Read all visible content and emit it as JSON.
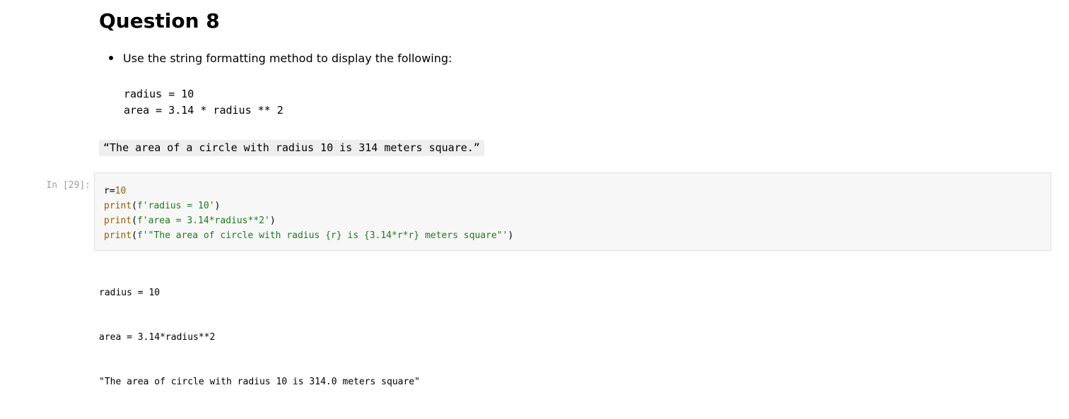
{
  "markdown": {
    "heading": "Question 8",
    "bullet": "Use the string formatting method to display the following:",
    "code_lines": [
      "radius = 10",
      "area = 3.14 * radius ** 2"
    ],
    "quote": "“The area of a circle with radius 10 is 314 meters square.”"
  },
  "code_cell": {
    "prompt": "In [29]:",
    "lines": [
      [
        {
          "text": "r=",
          "type": "plain"
        },
        {
          "text": "10",
          "type": "number"
        }
      ],
      [
        {
          "text": "print",
          "type": "builtin"
        },
        {
          "text": "(",
          "type": "plain"
        },
        {
          "text": "f'radius = 10'",
          "type": "string"
        },
        {
          "text": ")",
          "type": "plain"
        }
      ],
      [
        {
          "text": "print",
          "type": "builtin"
        },
        {
          "text": "(",
          "type": "plain"
        },
        {
          "text": "f'area = 3.14*radius**2'",
          "type": "string"
        },
        {
          "text": ")",
          "type": "plain"
        }
      ],
      [
        {
          "text": "print",
          "type": "builtin"
        },
        {
          "text": "(",
          "type": "plain"
        },
        {
          "text": "f'\"The area of circle with radius {r} is {3.14*r*r} meters square\"'",
          "type": "string"
        },
        {
          "text": ")",
          "type": "plain"
        }
      ]
    ]
  },
  "output": {
    "lines": [
      "radius = 10",
      "area = 3.14*radius**2",
      "\"The area of circle with radius 10 is 314.0 meters square\""
    ]
  },
  "colors": {
    "builtin": "#9c5a00",
    "string": "#1f7a1f",
    "number": "#9c5a00",
    "input_bg": "#f7f7f7",
    "prompt": "#9e9e9e",
    "quote_bg": "#eeeeee"
  }
}
